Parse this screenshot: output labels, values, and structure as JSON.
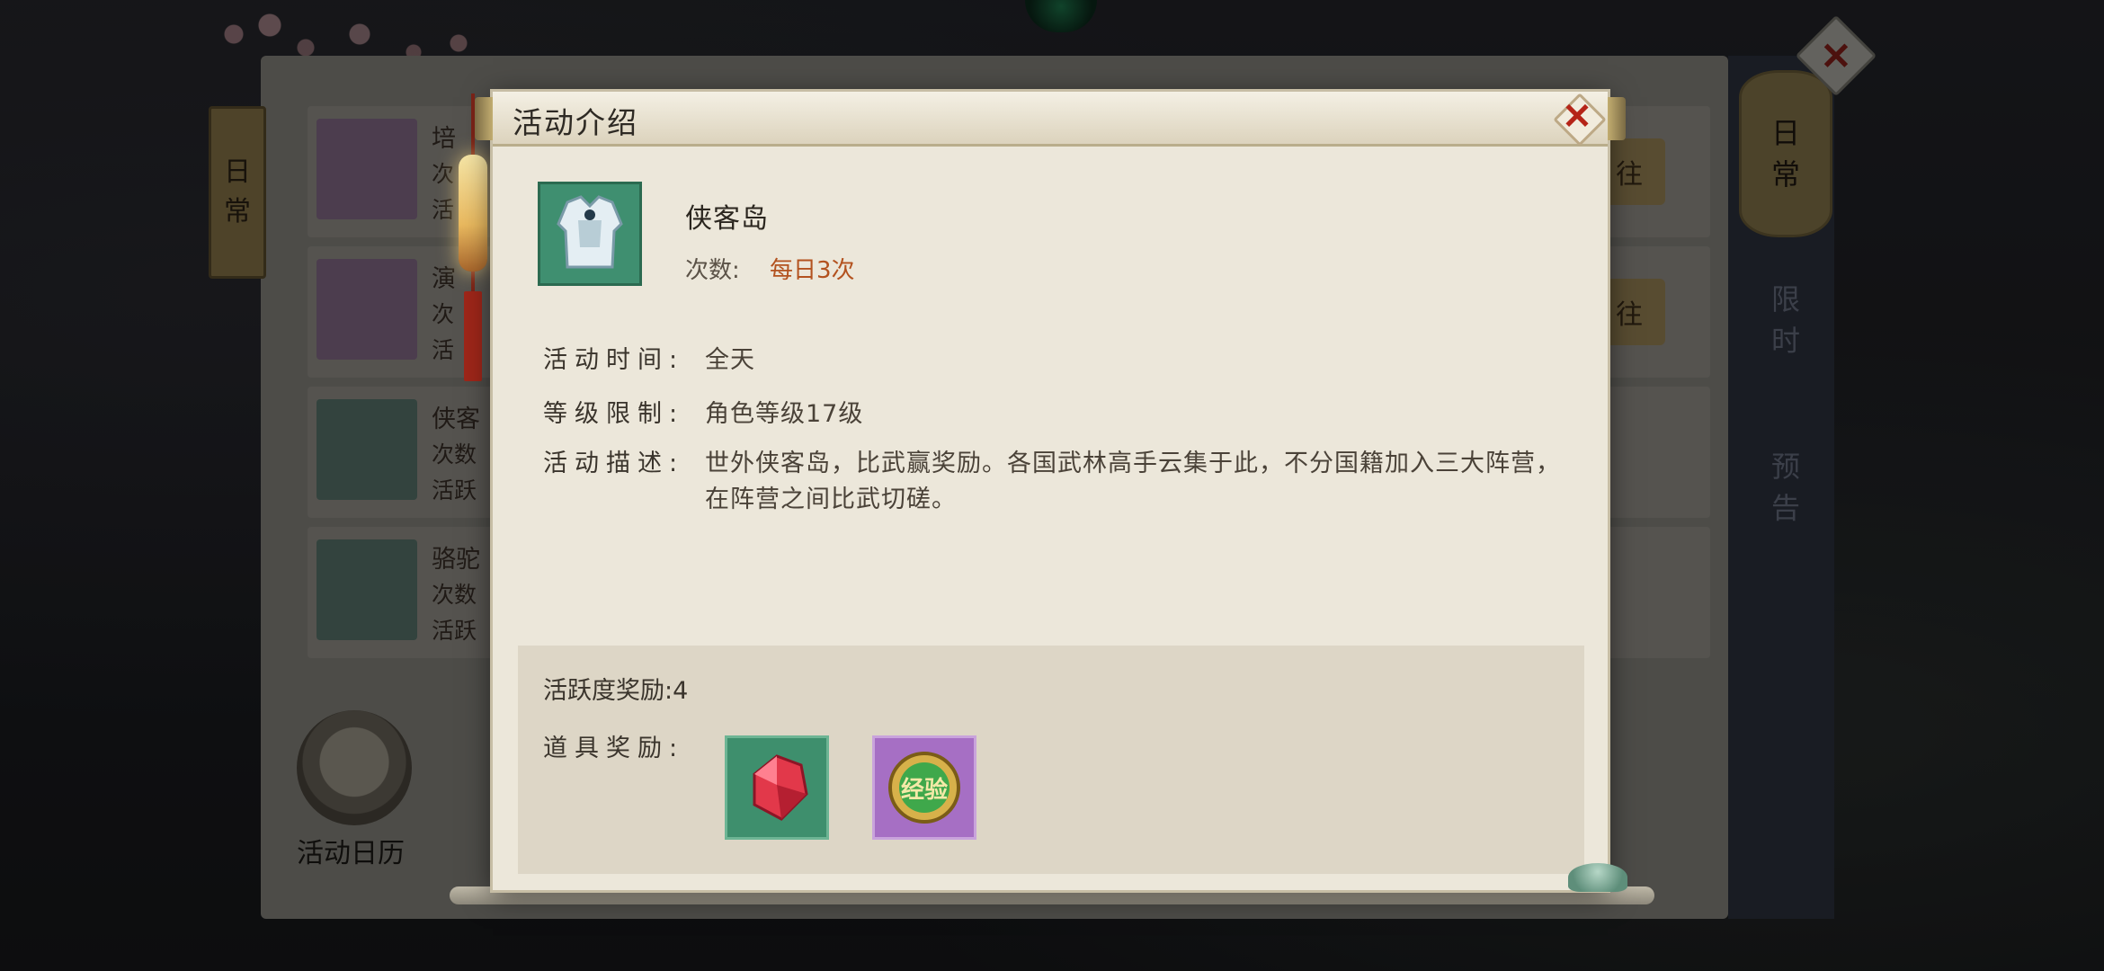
{
  "background": {
    "left_tab": [
      "日",
      "常"
    ],
    "right_tabs": {
      "daily": [
        "日",
        "常"
      ],
      "limited": [
        "限",
        "时"
      ],
      "preview": [
        "预",
        "告"
      ]
    },
    "activity_rows": [
      {
        "name": "培",
        "line1": "次",
        "line2": "活",
        "go": "往",
        "icon": "exp-orb-icon"
      },
      {
        "name": "演",
        "line1": "次",
        "line2": "活",
        "go": "往",
        "icon": "treasure-chest-icon"
      },
      {
        "name": "侠客",
        "line1": "次数",
        "line2": "活跃",
        "icon": "armor-icon"
      },
      {
        "name": "骆驼",
        "line1": "次数",
        "line2": "活跃",
        "icon": "teapot-icon"
      }
    ],
    "calendar_label": "活动日历"
  },
  "dialog": {
    "title": "活动介绍",
    "activity": {
      "name": "侠客岛",
      "count_label": "次数:",
      "count_value": "每日3次",
      "icon": "white-armor-icon"
    },
    "info": {
      "time_label": "活动时间:",
      "time_value": "全天",
      "level_label": "等级限制:",
      "level_value": "角色等级17级",
      "desc_label": "活动描述:",
      "desc_value": "世外侠客岛，比武赢奖励。各国武林高手云集于此，不分国籍加入三大阵营，在阵营之间比武切磋。"
    },
    "rewards": {
      "activity_label": "活跃度奖励:",
      "activity_value": "4",
      "items_label": "道具奖励:",
      "items": [
        {
          "icon": "red-gem-icon",
          "bg": "#3e8f6d"
        },
        {
          "icon": "exp-orb-icon",
          "label": "经验",
          "bg": "#a66fc4"
        }
      ]
    }
  },
  "colors": {
    "accent_orange": "#b3521f",
    "close_red": "#b52418",
    "dialog_bg": "#ece7da"
  }
}
